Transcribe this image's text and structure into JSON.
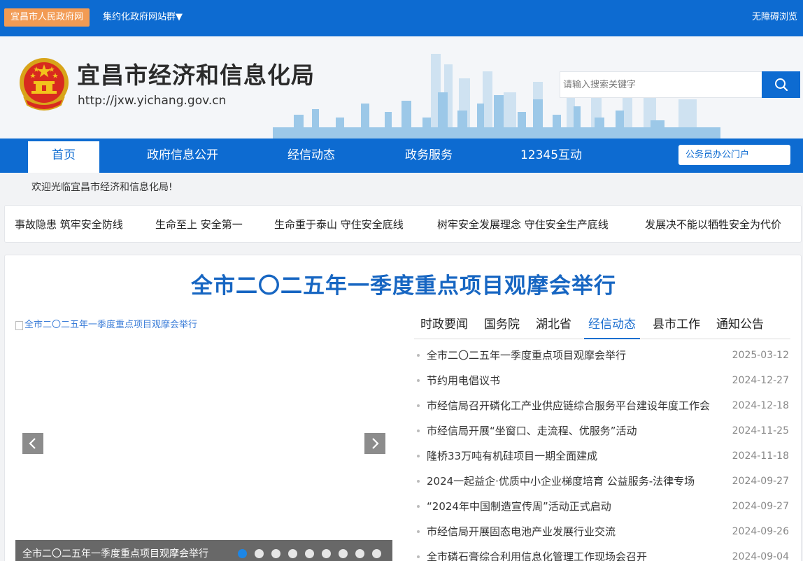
{
  "topbar": {
    "site_badge": "宜昌市人民政府网",
    "site_group": "集约化政府网站群▼",
    "accessibility": "无障碍浏览"
  },
  "header": {
    "org_name": "宜昌市经济和信息化局",
    "org_url": "http://jxw.yichang.gov.cn",
    "emblem_icon": "national-emblem-icon",
    "search_placeholder": "请输入搜索关键字",
    "search_icon": "search-icon"
  },
  "nav": {
    "items": [
      {
        "label": "首页",
        "active": true
      },
      {
        "label": "政府信息公开",
        "active": false
      },
      {
        "label": "经信动态",
        "active": false
      },
      {
        "label": "政务服务",
        "active": false
      },
      {
        "label": "12345互动",
        "active": false
      }
    ],
    "portal_button": "公务员办公门户"
  },
  "welcome": "欢迎光临宜昌市经济和信息化局!",
  "slogans": [
    "事故隐患 筑牢安全防线",
    "生命至上 安全第一",
    "生命重于泰山 守住安全底线",
    "树牢安全发展理念 守住安全生产底线",
    "发展决不能以牺牲安全为代价"
  ],
  "main": {
    "headline": "全市二〇二五年一季度重点项目观摩会举行",
    "slider": {
      "image_alt": "全市二〇二五年一季度重点项目观摩会举行",
      "caption": "全市二〇二五年一季度重点项目观摩会举行",
      "prev_icon": "chevron-left-icon",
      "next_icon": "chevron-right-icon",
      "dot_count": 9,
      "active_dot": 0
    },
    "tabs": [
      {
        "label": "时政要闻",
        "active": false
      },
      {
        "label": "国务院",
        "active": false
      },
      {
        "label": "湖北省",
        "active": false
      },
      {
        "label": "经信动态",
        "active": true
      },
      {
        "label": "县市工作",
        "active": false
      },
      {
        "label": "通知公告",
        "active": false
      }
    ],
    "news": [
      {
        "title": "全市二〇二五年一季度重点项目观摩会举行",
        "date": "2025-03-12"
      },
      {
        "title": "节约用电倡议书",
        "date": "2024-12-27"
      },
      {
        "title": "市经信局召开磷化工产业供应链综合服务平台建设年度工作会",
        "date": "2024-12-18"
      },
      {
        "title": "市经信局开展“坐窗口、走流程、优服务”活动",
        "date": "2024-11-25"
      },
      {
        "title": "隆桥33万吨有机硅项目一期全面建成",
        "date": "2024-11-18"
      },
      {
        "title": "2024一起益企·优质中小企业梯度培育 公益服务-法律专场",
        "date": "2024-09-27"
      },
      {
        "title": "“2024年中国制造宣传周”活动正式启动",
        "date": "2024-09-27"
      },
      {
        "title": "市经信局开展固态电池产业发展行业交流",
        "date": "2024-09-26"
      },
      {
        "title": "全市磷石膏综合利用信息化管理工作现场会召开",
        "date": "2024-09-04"
      }
    ]
  }
}
